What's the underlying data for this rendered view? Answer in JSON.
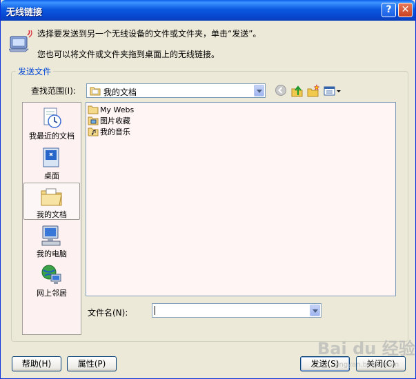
{
  "window": {
    "title": "无线链接",
    "help_glyph": "?",
    "close_glyph": "✕"
  },
  "info": {
    "line1": "选择要发送到另一个无线设备的文件或文件夹，单击“发送”。",
    "line2": "您也可以将文件或文件夹拖到桌面上的无线链接。"
  },
  "send_group": {
    "title": "发送文件",
    "look_in_label": "查找范围(I):",
    "look_in_value": "我的文档",
    "places": [
      {
        "label": "我最近的文档",
        "icon": "recent-documents-icon"
      },
      {
        "label": "桌面",
        "icon": "desktop-icon"
      },
      {
        "label": "我的文档",
        "icon": "my-documents-icon"
      },
      {
        "label": "我的电脑",
        "icon": "my-computer-icon"
      },
      {
        "label": "网上邻居",
        "icon": "network-places-icon"
      }
    ],
    "files": [
      {
        "name": "My Webs",
        "icon": "folder-icon"
      },
      {
        "name": "图片收藏",
        "icon": "folder-pictures-icon"
      },
      {
        "name": "我的音乐",
        "icon": "folder-music-icon"
      }
    ],
    "filename_label": "文件名(N):",
    "filename_value": ""
  },
  "buttons": {
    "help": "帮助(H)",
    "properties": "属性(P)",
    "send": "发送(S)",
    "close": "关闭(C)"
  },
  "watermark": {
    "text": "Bai du 经验",
    "sub": "jingyan.baidu.com"
  },
  "colors": {
    "title_bar": "#0a5fe8",
    "window_bg": "#ece9d8",
    "group_title": "#0046d5",
    "places_bg": "#fdf1f1",
    "list_bg": "#fff5f5"
  }
}
